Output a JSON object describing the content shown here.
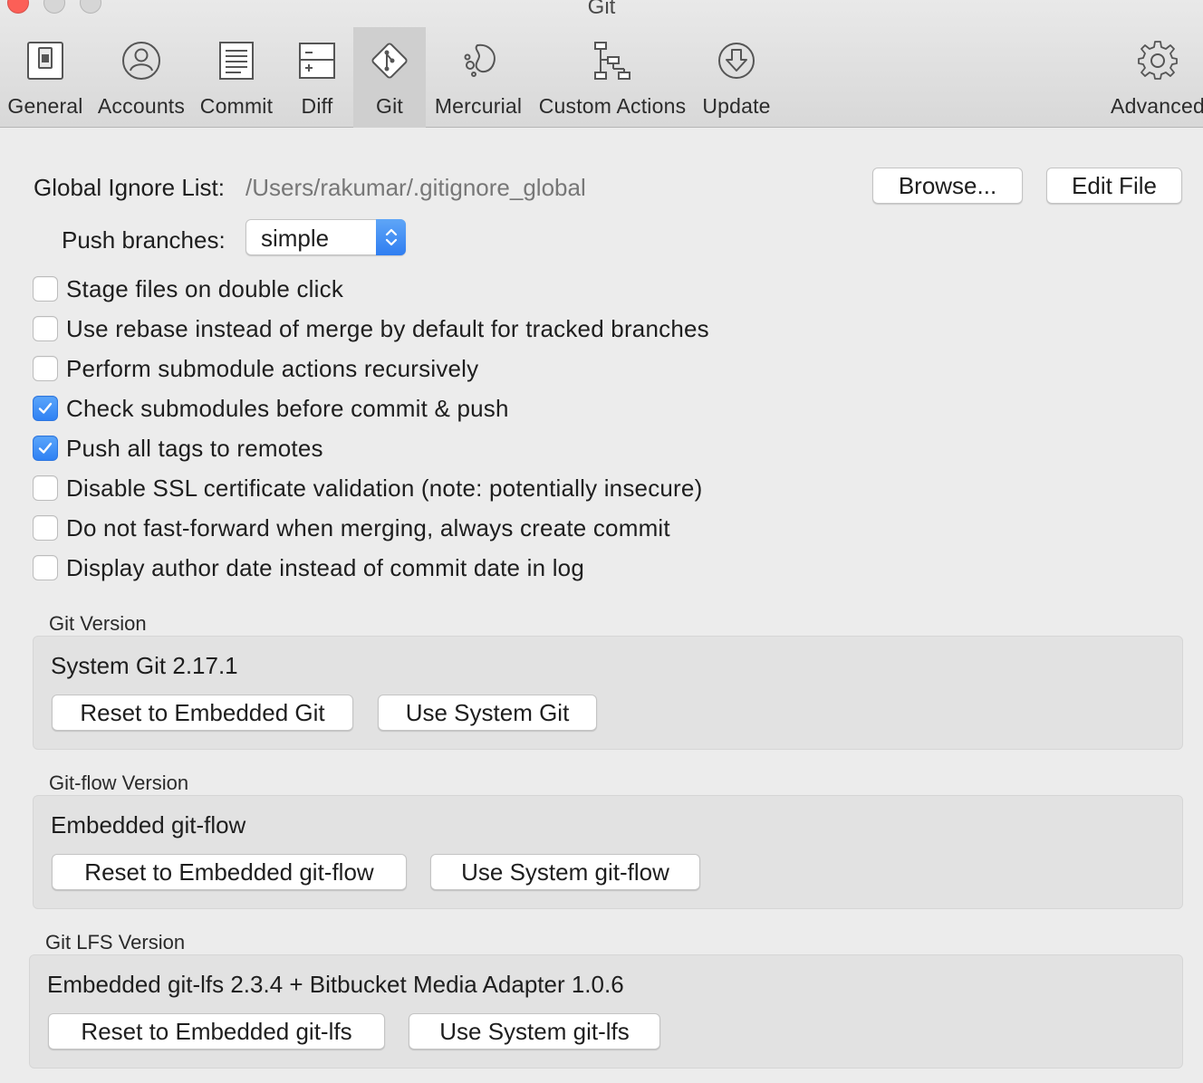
{
  "window": {
    "title": "Git"
  },
  "toolbar": {
    "tabs": [
      {
        "label": "General",
        "icon": "switch-icon"
      },
      {
        "label": "Accounts",
        "icon": "person-icon"
      },
      {
        "label": "Commit",
        "icon": "document-lines-icon"
      },
      {
        "label": "Diff",
        "icon": "diff-icon"
      },
      {
        "label": "Git",
        "icon": "git-diamond-icon",
        "selected": true
      },
      {
        "label": "Mercurial",
        "icon": "mercurial-icon"
      },
      {
        "label": "Custom Actions",
        "icon": "custom-actions-icon"
      },
      {
        "label": "Update",
        "icon": "download-arrow-icon"
      },
      {
        "label": "Advanced",
        "icon": "gear-icon"
      }
    ]
  },
  "main": {
    "ignore": {
      "label": "Global Ignore List:",
      "path": "/Users/rakumar/.gitignore_global",
      "browse_label": "Browse...",
      "edit_label": "Edit File"
    },
    "push": {
      "label": "Push branches:",
      "value": "simple"
    },
    "options": [
      {
        "label": "Stage files on double click",
        "checked": false
      },
      {
        "label": "Use rebase instead of merge by default for tracked branches",
        "checked": false
      },
      {
        "label": "Perform submodule actions recursively",
        "checked": false
      },
      {
        "label": "Check submodules before commit & push",
        "checked": true
      },
      {
        "label": "Push all tags to remotes",
        "checked": true
      },
      {
        "label": "Disable SSL certificate validation (note: potentially insecure)",
        "checked": false
      },
      {
        "label": "Do not fast-forward when merging, always create commit",
        "checked": false
      },
      {
        "label": "Display author date instead of commit date in log",
        "checked": false
      }
    ],
    "git_version": {
      "title": "Git Version",
      "value": "System Git 2.17.1",
      "reset_label": "Reset to Embedded Git",
      "use_label": "Use System Git"
    },
    "gitflow_version": {
      "title": "Git-flow Version",
      "value": "Embedded git-flow",
      "reset_label": "Reset to Embedded git-flow",
      "use_label": "Use System git-flow"
    },
    "lfs_version": {
      "title": "Git LFS Version",
      "value": "Embedded git-lfs 2.3.4 + Bitbucket Media Adapter 1.0.6",
      "reset_label": "Reset to Embedded git-lfs",
      "use_label": "Use System git-lfs"
    }
  },
  "colors": {
    "accent": "#2f7ef1",
    "close": "#fc5f57",
    "background": "#ececec"
  }
}
